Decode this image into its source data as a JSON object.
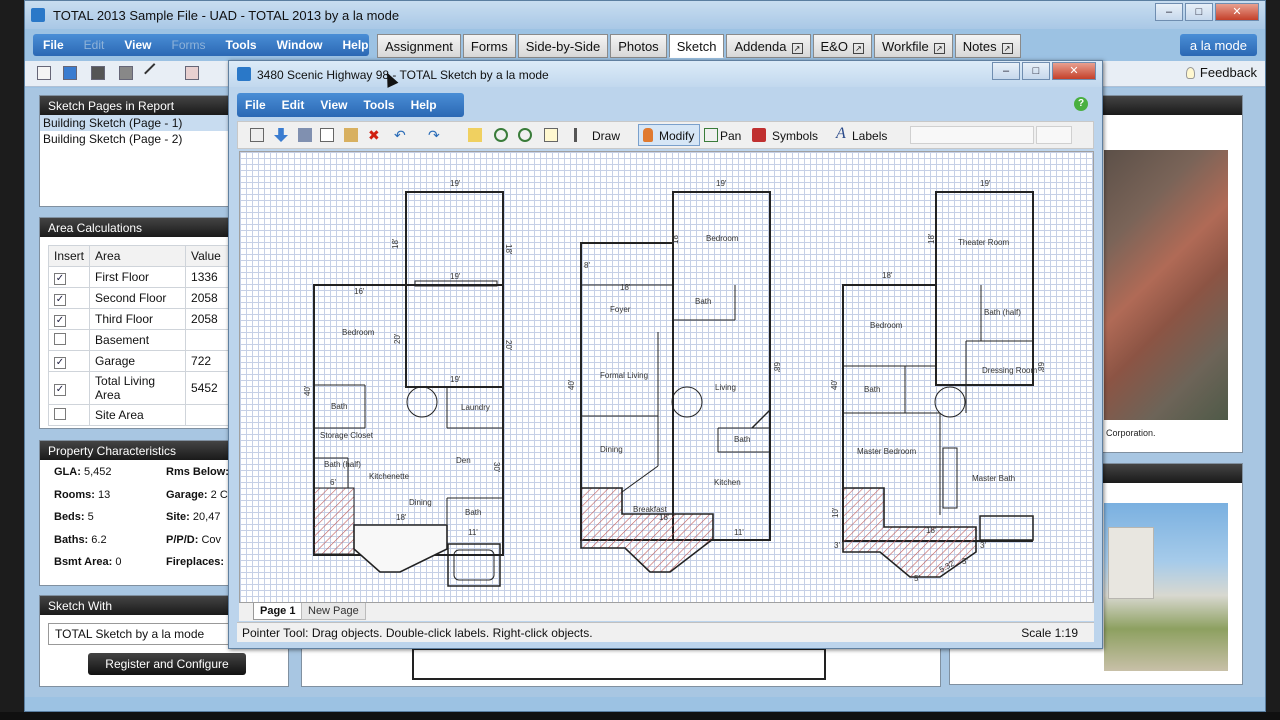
{
  "outer": {
    "title": "TOTAL 2013 Sample File - UAD - TOTAL 2013 by a la mode",
    "menu": [
      {
        "label": "File",
        "enabled": true
      },
      {
        "label": "Edit",
        "enabled": false
      },
      {
        "label": "View",
        "enabled": true
      },
      {
        "label": "Forms",
        "enabled": false
      },
      {
        "label": "Tools",
        "enabled": true
      },
      {
        "label": "Window",
        "enabled": true
      },
      {
        "label": "Help",
        "enabled": true
      }
    ],
    "tabs": [
      {
        "label": "Assignment",
        "ext": false
      },
      {
        "label": "Forms",
        "ext": false
      },
      {
        "label": "Side-by-Side",
        "ext": false
      },
      {
        "label": "Photos",
        "ext": false
      },
      {
        "label": "Sketch",
        "ext": false,
        "active": true
      },
      {
        "label": "Addenda",
        "ext": true
      },
      {
        "label": "E&O",
        "ext": true
      },
      {
        "label": "Workfile",
        "ext": true
      },
      {
        "label": "Notes",
        "ext": true
      }
    ],
    "brand_button": "a la mode",
    "feedback": "Feedback",
    "window_buttons": {
      "minimize": "–",
      "maximize": "□",
      "close": "✕"
    }
  },
  "sketch_pages": {
    "header": "Sketch Pages in Report",
    "items": [
      "Building Sketch (Page - 1)",
      "Building Sketch (Page - 2)"
    ]
  },
  "area_calc": {
    "header": "Area Calculations",
    "columns": [
      "Insert",
      "Area",
      "Value"
    ],
    "rows": [
      {
        "checked": true,
        "area": "First Floor",
        "value": "1336"
      },
      {
        "checked": true,
        "area": "Second Floor",
        "value": "2058"
      },
      {
        "checked": true,
        "area": "Third Floor",
        "value": "2058"
      },
      {
        "checked": false,
        "area": "Basement",
        "value": ""
      },
      {
        "checked": true,
        "area": "Garage",
        "value": "722"
      },
      {
        "checked": true,
        "area": "Total Living Area",
        "value": "5452"
      },
      {
        "checked": false,
        "area": "Site Area",
        "value": ""
      }
    ]
  },
  "property": {
    "header": "Property Characteristics",
    "left": [
      {
        "label": "GLA:",
        "value": "5,452"
      },
      {
        "label": "Rooms:",
        "value": "13"
      },
      {
        "label": "Beds:",
        "value": "5"
      },
      {
        "label": "Baths:",
        "value": "6.2"
      },
      {
        "label": "Bsmt Area:",
        "value": "0"
      }
    ],
    "right": [
      {
        "label": "Rms Below:",
        "value": ""
      },
      {
        "label": "Garage:",
        "value": "2 C"
      },
      {
        "label": "Site:",
        "value": "20,47"
      },
      {
        "label": "P/P/D:",
        "value": "Cov"
      },
      {
        "label": "Fireplaces:",
        "value": ""
      }
    ]
  },
  "sketch_with": {
    "header": "Sketch With",
    "selected": "TOTAL Sketch by a la mode",
    "register_button": "Register and Configure"
  },
  "aerial_caption": "Corporation.",
  "sketch_window": {
    "title": "3480 Scenic Highway 98 - TOTAL Sketch by a la mode",
    "menu": [
      "File",
      "Edit",
      "View",
      "Tools",
      "Help"
    ],
    "help_icon": "?",
    "tools": {
      "draw": "Draw",
      "modify": "Modify",
      "pan": "Pan",
      "symbols": "Symbols",
      "labels": "Labels"
    },
    "pages": {
      "active": "Page 1",
      "new": "New Page"
    },
    "status": "Pointer Tool: Drag objects. Double-click labels. Right-click objects.",
    "scale": "Scale 1:19"
  },
  "plans": [
    {
      "rooms": [
        "Bedroom",
        "Bath",
        "Laundry",
        "Storage Closet",
        "Bath (half)",
        "Kitchenette",
        "Den",
        "Dining",
        "Bath"
      ],
      "dims": [
        "19'",
        "18'",
        "18'",
        "19'",
        "16'",
        "20'",
        "20'",
        "19'",
        "40'",
        "30'",
        "6'",
        "18'",
        "11'"
      ]
    },
    {
      "rooms": [
        "Bedroom",
        "Bath",
        "Foyer",
        "Formal Living",
        "Living",
        "Dining",
        "Bath",
        "Kitchen",
        "Breakfast"
      ],
      "dims": [
        "19'",
        "18'",
        "18'",
        "8'",
        "40'",
        "68'",
        "18'",
        "11'"
      ]
    },
    {
      "rooms": [
        "Theater Room",
        "Bedroom",
        "Bath (half)",
        "Dressing Room",
        "Bath",
        "Master Bedroom",
        "Master Bath"
      ],
      "dims": [
        "19'",
        "18'",
        "18'",
        "40'",
        "68'",
        "10'",
        "3'",
        "5'",
        "5.32'",
        "5'",
        "18'",
        "3'"
      ]
    }
  ]
}
